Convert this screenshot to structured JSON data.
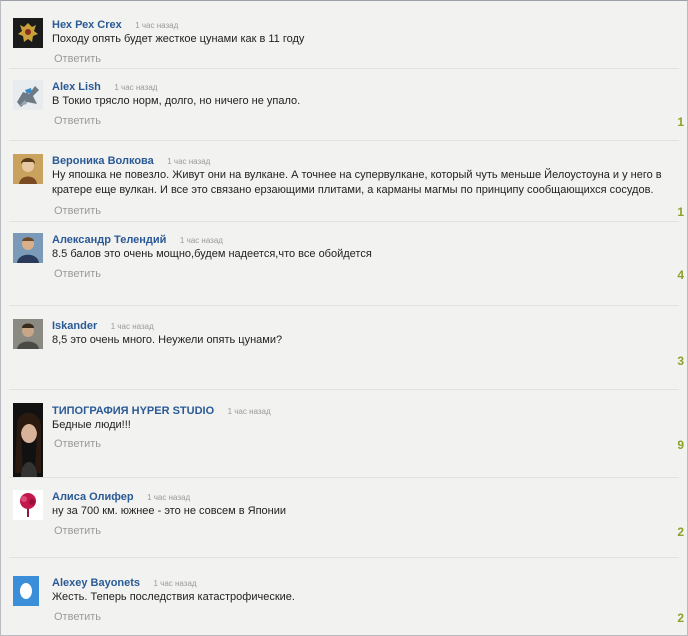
{
  "comments": [
    {
      "author": "Нех Рех Crex",
      "time": "1 час назад",
      "text": "Походу опять будет жесткое цунами как в 11 году",
      "reply": "Ответить",
      "likes": ""
    },
    {
      "author": "Alex Lish",
      "time": "1 час назад",
      "text": "В Токио трясло норм, долго, но ничего не упало.",
      "reply": "Ответить",
      "likes": "1"
    },
    {
      "author": "Вероника Волкова",
      "time": "1 час назад",
      "text": "Ну япошка не повезло. Живут они на вулкане. А точнее на супервулкане, который чуть меньше Йелоустоуна и у него в кратере еще вулкан. И все это связано ерзающими плитами, а карманы магмы по принципу сообщающихся сосудов.",
      "reply": "Ответить",
      "likes": "1"
    },
    {
      "author": "Александр Телендий",
      "time": "1 час назад",
      "text": "8.5 балов это очень мощно,будем надеется,что все обойдется",
      "reply": "Ответить",
      "likes": "4"
    },
    {
      "author": "Iskander",
      "time": "1 час назад",
      "text": "8,5 это очень много. Неужели опять цунами?",
      "reply": "Ответить",
      "likes": "3"
    },
    {
      "author": "ТИПОГРАФИЯ HYPER STUDIO",
      "time": "1 час назад",
      "text": "Бедные люди!!!",
      "reply": "Ответить",
      "likes": "9"
    },
    {
      "author": "Алиса Олифер",
      "time": "1 час назад",
      "text": "ну за 700 км. южнее - это не совсем в Японии",
      "reply": "Ответить",
      "likes": "2"
    },
    {
      "author": "Alexey Bayonets",
      "time": "1 час назад",
      "text": "Жесть. Теперь последствия катастрофические.",
      "reply": "Ответить",
      "likes": "2"
    }
  ]
}
